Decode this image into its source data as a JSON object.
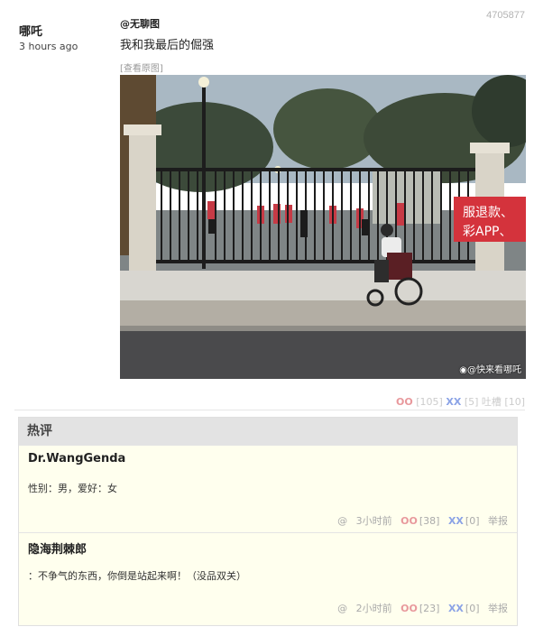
{
  "post": {
    "id": "4705877",
    "author": "哪吒",
    "time": "3 hours ago",
    "title": "@无聊图",
    "text": "我和我最后的倔强",
    "view_original": "[查看原图]",
    "watermark": "快来看哪吒",
    "votes": {
      "oo_label": "OO",
      "oo_count": "[105]",
      "xx_label": "XX",
      "xx_count": "[5]",
      "tucao_label": "吐槽",
      "tucao_count": "[10]"
    }
  },
  "hot": {
    "header": "热评",
    "comments": [
      {
        "author": "Dr.WangGenda",
        "text": "性别：男，爱好：女",
        "at": "@",
        "time": "3小时前",
        "oo_label": "OO",
        "oo_count": "[38]",
        "xx_label": "XX",
        "xx_count": "[0]",
        "report": "举报"
      },
      {
        "author": "隐海荆棘郎",
        "text": "：不争气的东西，你倒是站起来啊！（没品双关）",
        "at": "@",
        "time": "2小时前",
        "oo_label": "OO",
        "oo_count": "[23]",
        "xx_label": "XX",
        "xx_count": "[0]",
        "report": "举报"
      }
    ]
  },
  "photo_banner_text": "服退款、\n彩APP、"
}
